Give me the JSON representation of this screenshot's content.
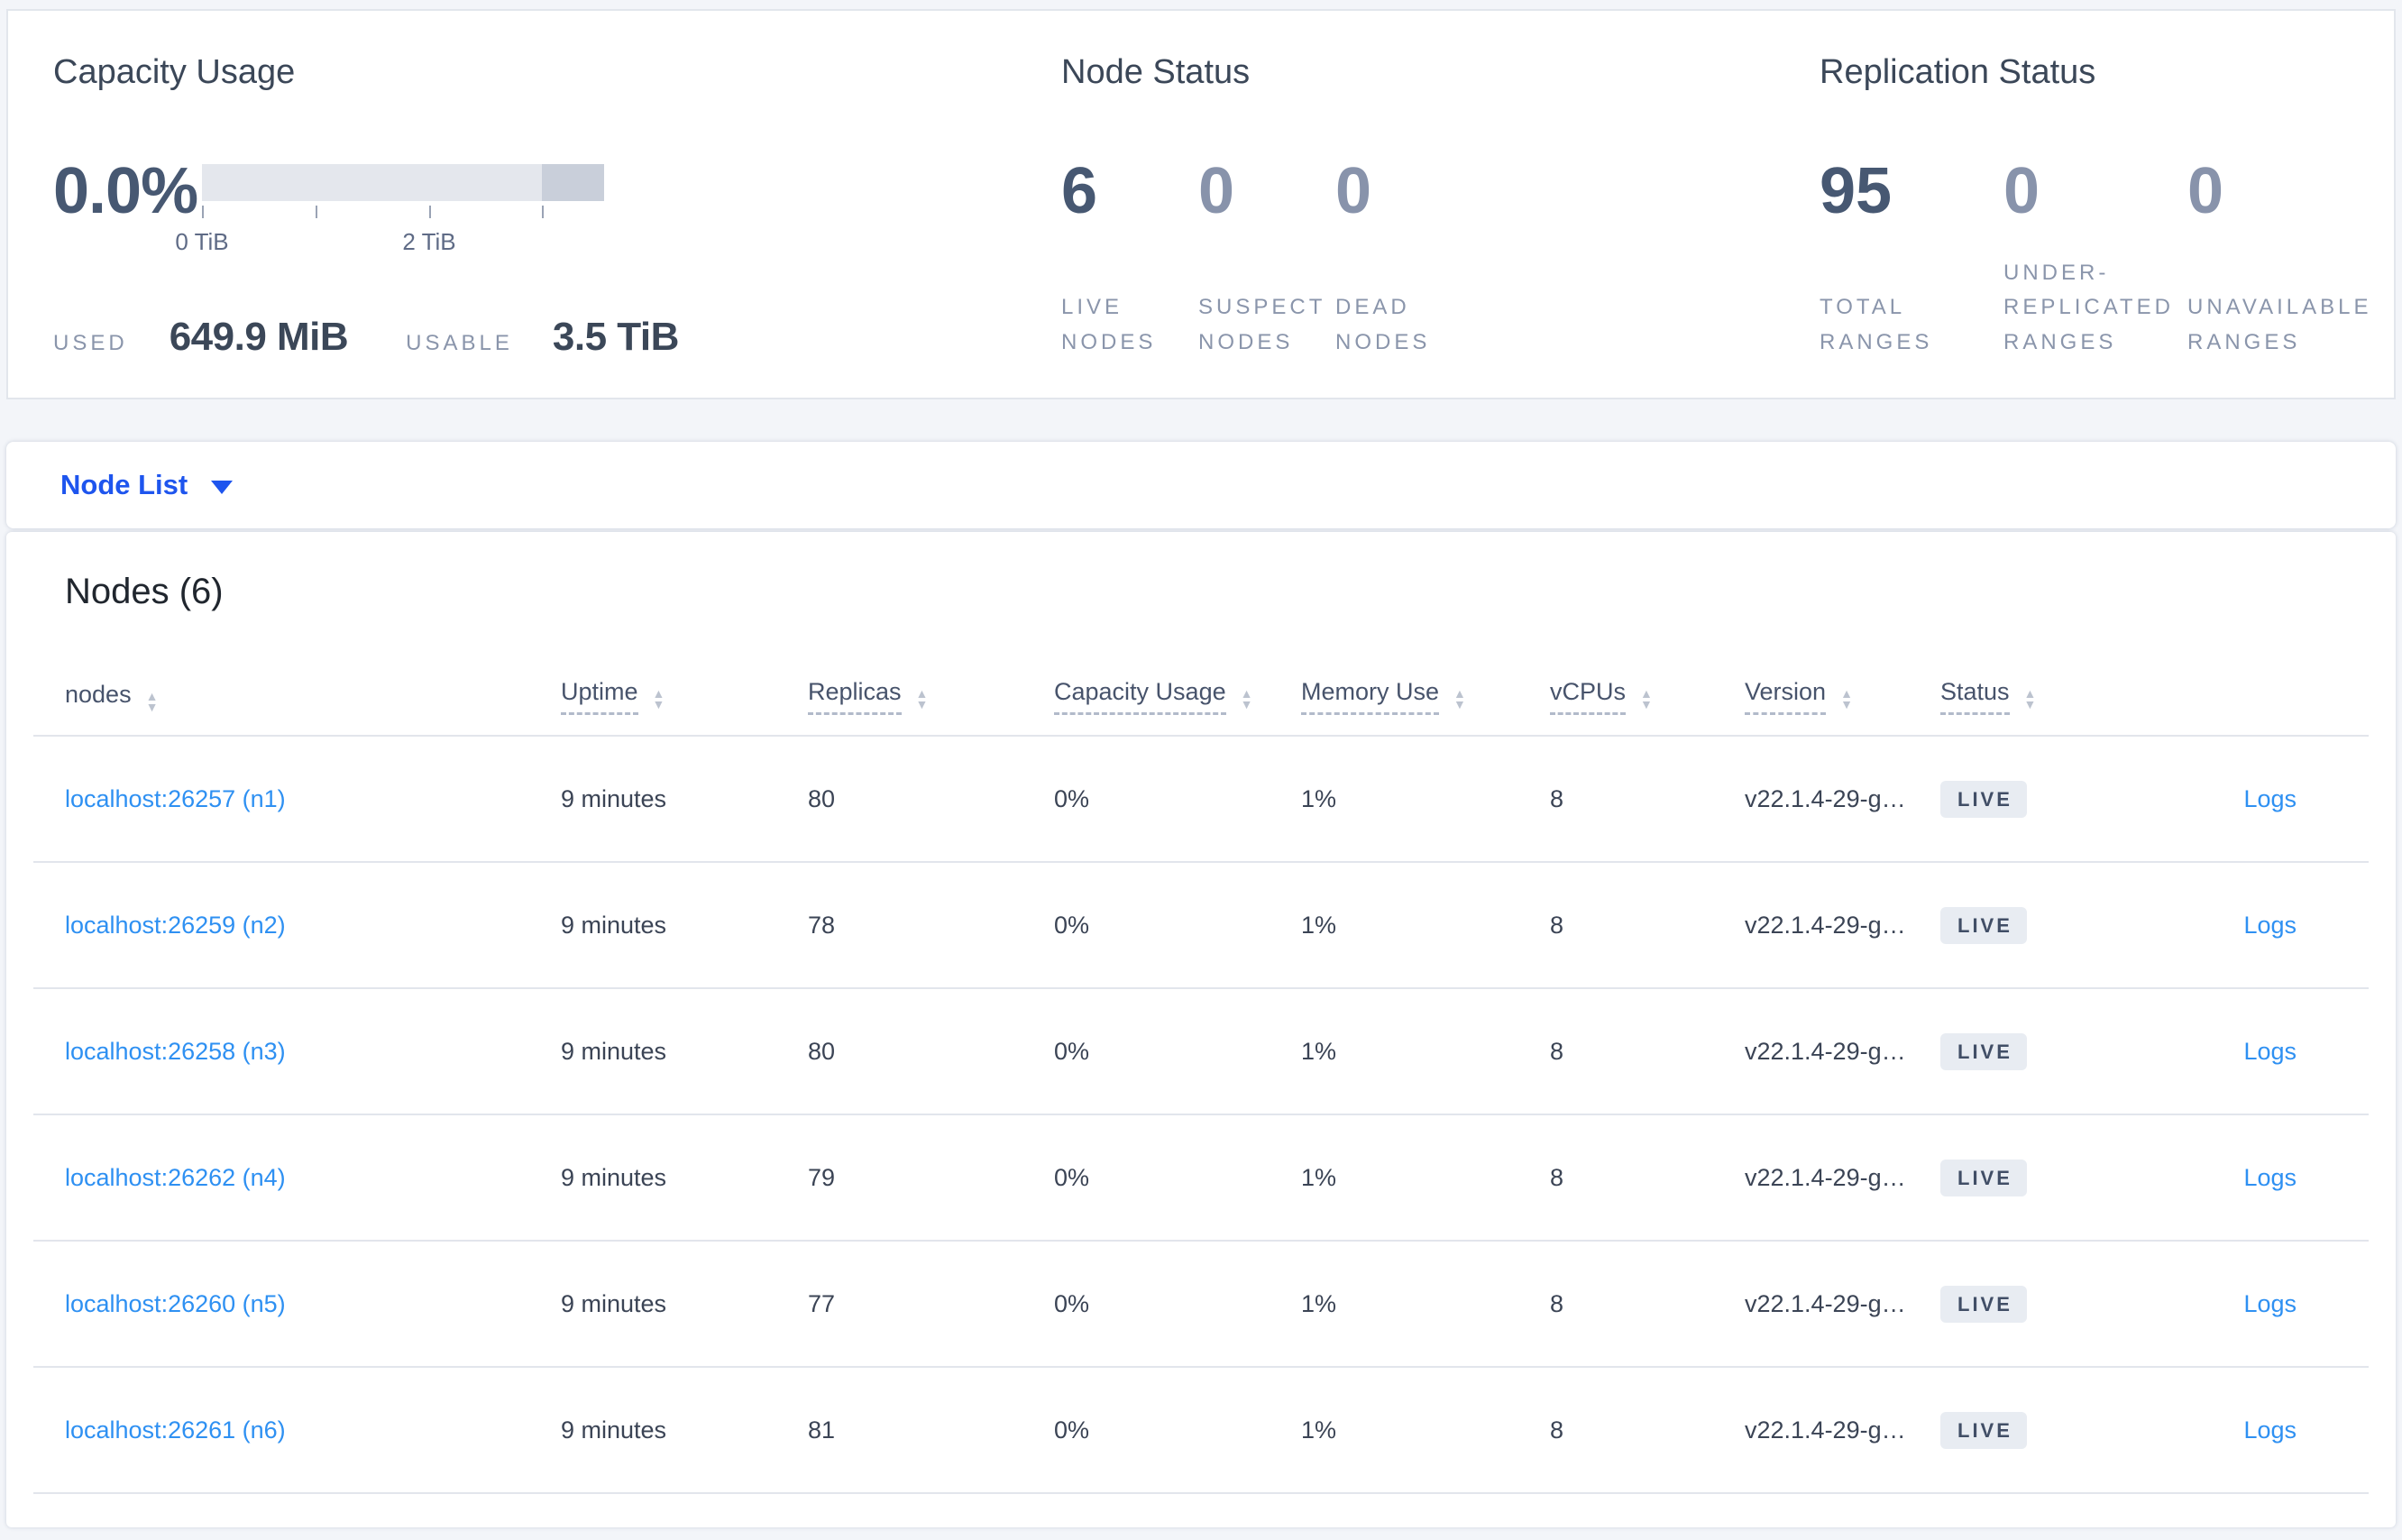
{
  "summary": {
    "capacity": {
      "title": "Capacity Usage",
      "percent": "0.0%",
      "bar": {
        "track_color": "#e4e7ed",
        "segment_color": "#c9cfda",
        "segment_start_pct": 84.5,
        "segment_end_pct": 100
      },
      "axis_ticks": [
        {
          "pos_pct": 0,
          "label": "0 TiB"
        },
        {
          "pos_pct": 28.2,
          "label": ""
        },
        {
          "pos_pct": 56.5,
          "label": "2 TiB"
        },
        {
          "pos_pct": 84.5,
          "label": ""
        }
      ],
      "used_label": "USED",
      "used_value": "649.9 MiB",
      "usable_label": "USABLE",
      "usable_value": "3.5 TiB"
    },
    "node_status": {
      "title": "Node Status",
      "stats": [
        {
          "value": "6",
          "label": "LIVE NODES"
        },
        {
          "value": "0",
          "label": "SUSPECT NODES"
        },
        {
          "value": "0",
          "label": "DEAD NODES"
        }
      ]
    },
    "replication_status": {
      "title": "Replication Status",
      "stats": [
        {
          "value": "95",
          "label": "TOTAL RANGES"
        },
        {
          "value": "0",
          "label": "UNDER-REPLICATED RANGES"
        },
        {
          "value": "0",
          "label": "UNAVAILABLE RANGES"
        }
      ]
    }
  },
  "view_selector": {
    "label": "Node List"
  },
  "nodes_table": {
    "title": "Nodes (6)",
    "logs_label": "Logs",
    "columns": [
      {
        "key": "node",
        "label": "nodes",
        "tooltip": false
      },
      {
        "key": "uptime",
        "label": "Uptime",
        "tooltip": true
      },
      {
        "key": "replicas",
        "label": "Replicas",
        "tooltip": true
      },
      {
        "key": "capacity",
        "label": "Capacity Usage",
        "tooltip": true
      },
      {
        "key": "memory",
        "label": "Memory Use",
        "tooltip": true
      },
      {
        "key": "vcpus",
        "label": "vCPUs",
        "tooltip": true
      },
      {
        "key": "version",
        "label": "Version",
        "tooltip": true
      },
      {
        "key": "status",
        "label": "Status",
        "tooltip": true
      }
    ],
    "rows": [
      {
        "node": "localhost:26257 (n1)",
        "uptime": "9 minutes",
        "replicas": "80",
        "capacity": "0%",
        "memory": "1%",
        "vcpus": "8",
        "version": "v22.1.4-29-g…",
        "status": "LIVE"
      },
      {
        "node": "localhost:26259 (n2)",
        "uptime": "9 minutes",
        "replicas": "78",
        "capacity": "0%",
        "memory": "1%",
        "vcpus": "8",
        "version": "v22.1.4-29-g…",
        "status": "LIVE"
      },
      {
        "node": "localhost:26258 (n3)",
        "uptime": "9 minutes",
        "replicas": "80",
        "capacity": "0%",
        "memory": "1%",
        "vcpus": "8",
        "version": "v22.1.4-29-g…",
        "status": "LIVE"
      },
      {
        "node": "localhost:26262 (n4)",
        "uptime": "9 minutes",
        "replicas": "79",
        "capacity": "0%",
        "memory": "1%",
        "vcpus": "8",
        "version": "v22.1.4-29-g…",
        "status": "LIVE"
      },
      {
        "node": "localhost:26260 (n5)",
        "uptime": "9 minutes",
        "replicas": "77",
        "capacity": "0%",
        "memory": "1%",
        "vcpus": "8",
        "version": "v22.1.4-29-g…",
        "status": "LIVE"
      },
      {
        "node": "localhost:26261 (n6)",
        "uptime": "9 minutes",
        "replicas": "81",
        "capacity": "0%",
        "memory": "1%",
        "vcpus": "8",
        "version": "v22.1.4-29-g…",
        "status": "LIVE"
      }
    ]
  }
}
